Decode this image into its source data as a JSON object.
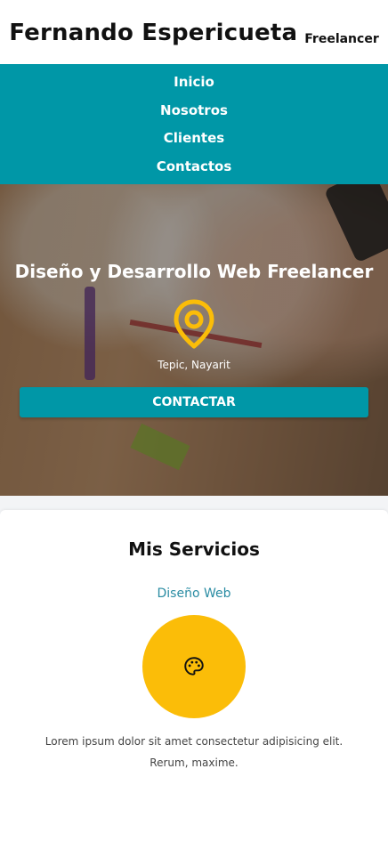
{
  "header": {
    "name": "Fernando Espericueta",
    "tagline": "Freelancer"
  },
  "nav": {
    "items": [
      "Inicio",
      "Nosotros",
      "Clientes",
      "Contactos"
    ]
  },
  "hero": {
    "title": "Diseño y Desarrollo Web Freelancer",
    "location": "Tepic, Nayarit",
    "cta": "CONTACTAR",
    "icon": "map-pin-icon"
  },
  "services": {
    "heading": "Mis Servicios",
    "item_title": "Diseño Web",
    "item_icon": "palette-icon",
    "item_desc": "Lorem ipsum dolor sit amet consectetur adipisicing elit. Rerum, maxime."
  },
  "colors": {
    "primary": "#0097a7",
    "accent": "#fbbd08",
    "link": "#2a8ca3"
  }
}
